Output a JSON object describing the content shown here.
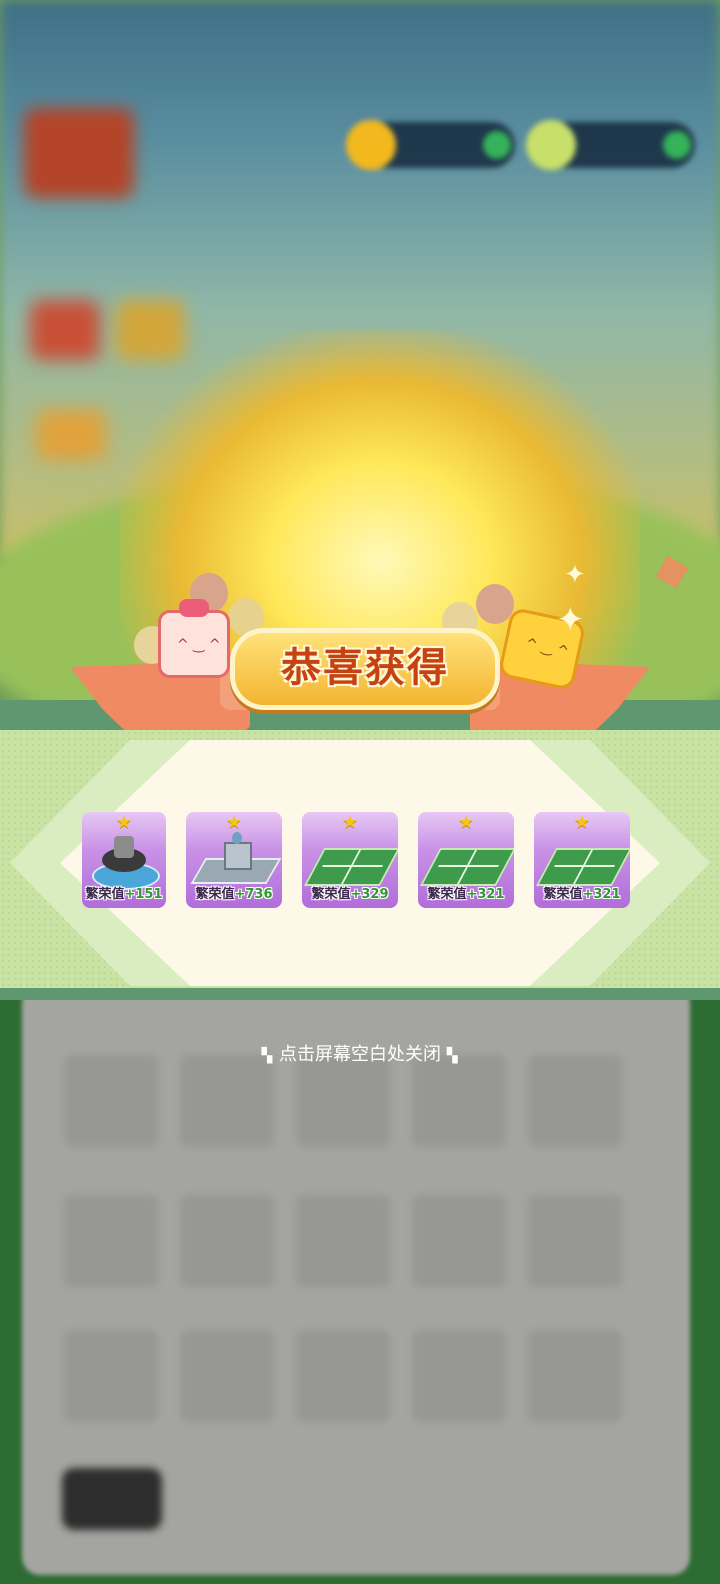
{
  "dialog": {
    "title": "恭喜获得",
    "close_hint": "点击屏幕空白处关闭",
    "deco_left": "▚",
    "deco_right": "▚"
  },
  "rewards": [
    {
      "label": "繁荣值",
      "value": "+151",
      "icon": "fountain-statue-icon"
    },
    {
      "label": "繁荣值",
      "value": "+736",
      "icon": "factory-building-icon"
    },
    {
      "label": "繁荣值",
      "value": "+329",
      "icon": "tennis-court-icon"
    },
    {
      "label": "繁荣值",
      "value": "+321",
      "icon": "tennis-court-icon"
    },
    {
      "label": "繁荣值",
      "value": "+321",
      "icon": "tennis-court-icon"
    }
  ],
  "rarity_star": "★",
  "colors": {
    "card_purple": "#c891e6",
    "ribbon": "#f08a62",
    "title_red": "#c64212",
    "value_green": "#2f9a2f",
    "band_green": "#5f9770"
  }
}
